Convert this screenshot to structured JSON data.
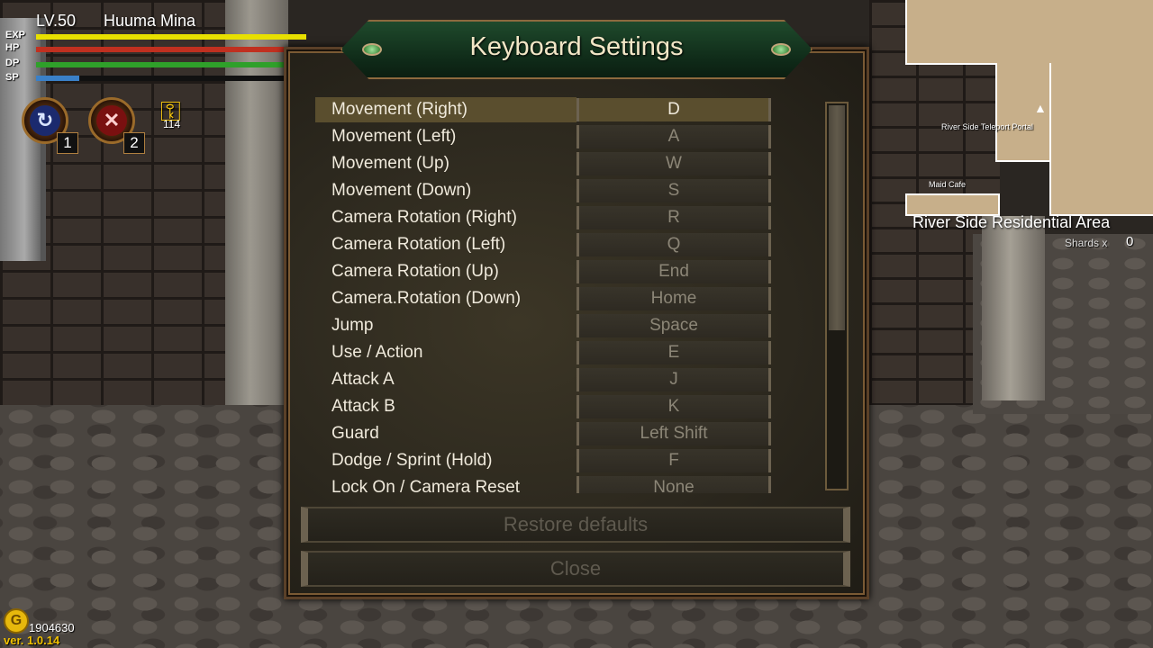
{
  "hud": {
    "level": "LV.50",
    "player_name": "Huuma Mina",
    "bars": [
      {
        "label": "EXP",
        "fill": 1.0,
        "color": "#e8e000"
      },
      {
        "label": "HP",
        "fill": 1.0,
        "color": "#c03020"
      },
      {
        "label": "DP",
        "fill": 1.0,
        "color": "#2fa02a"
      },
      {
        "label": "SP",
        "fill": 0.16,
        "color": "#3a80c8"
      }
    ],
    "skills": [
      {
        "icon": "swirl-skill-icon",
        "slot": "1"
      },
      {
        "icon": "slash-skill-icon",
        "slot": "2"
      }
    ],
    "key_icon": "key-icon",
    "key_count": "114",
    "gold_icon": "G",
    "gold_amount": "1904630",
    "version": "ver. 1.0.14"
  },
  "minimap": {
    "labels": [
      "River Side Teleport Portal",
      "Maid Cafe"
    ],
    "area_name": "River Side Residential Area",
    "shards_label": "Shards x",
    "shards_value": "0"
  },
  "dialog": {
    "title": "Keyboard Settings",
    "bindings": [
      {
        "action": "Movement (Right)",
        "key": "D"
      },
      {
        "action": "Movement (Left)",
        "key": "A"
      },
      {
        "action": "Movement (Up)",
        "key": "W"
      },
      {
        "action": "Movement (Down)",
        "key": "S"
      },
      {
        "action": "Camera Rotation (Right)",
        "key": "R"
      },
      {
        "action": "Camera Rotation (Left)",
        "key": "Q"
      },
      {
        "action": "Camera Rotation (Up)",
        "key": "End"
      },
      {
        "action": "Camera.Rotation (Down)",
        "key": "Home"
      },
      {
        "action": "Jump",
        "key": "Space"
      },
      {
        "action": "Use / Action",
        "key": "E"
      },
      {
        "action": "Attack A",
        "key": "J"
      },
      {
        "action": "Attack B",
        "key": "K"
      },
      {
        "action": "Guard",
        "key": "Left Shift"
      },
      {
        "action": "Dodge / Sprint (Hold)",
        "key": "F"
      },
      {
        "action": "Lock On / Camera Reset",
        "key": "None"
      }
    ],
    "selected_index": 0,
    "restore_label": "Restore defaults",
    "close_label": "Close"
  }
}
